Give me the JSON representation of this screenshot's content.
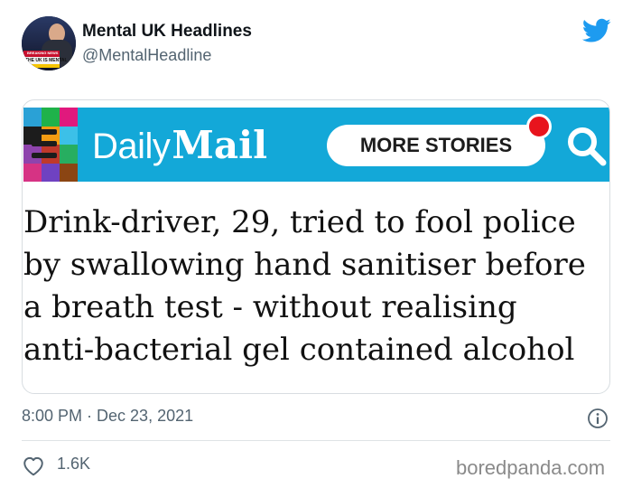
{
  "tweet": {
    "display_name": "Mental UK Headlines",
    "handle": "@MentalHeadline",
    "avatar_text_1": "BREAKING NEWS",
    "avatar_text_2": "THE UK IS MENTAL",
    "timestamp": "8:00 PM · Dec 23, 2021",
    "like_count": "1.6K"
  },
  "card": {
    "brand_daily": "Daily",
    "brand_mail": "Mail",
    "more_stories_label": "MORE STORIES",
    "headline_lines": [
      "Drink-driver, 29, tried to fool police",
      "by swallowing hand sanitiser before",
      "a breath test - without realising",
      "anti-bacterial gel contained alcohol"
    ]
  },
  "watermark": "boredpanda.com",
  "icons": {
    "twitter": "twitter-bird-icon",
    "menu": "menu-icon",
    "notification": "notification-dot-icon",
    "search": "search-icon",
    "info": "info-icon",
    "like": "heart-icon"
  },
  "colors": {
    "twitter_blue": "#1d9bf0",
    "banner_blue": "#13a8d8",
    "notification_red": "#e8141d",
    "secondary_text": "#536471"
  }
}
